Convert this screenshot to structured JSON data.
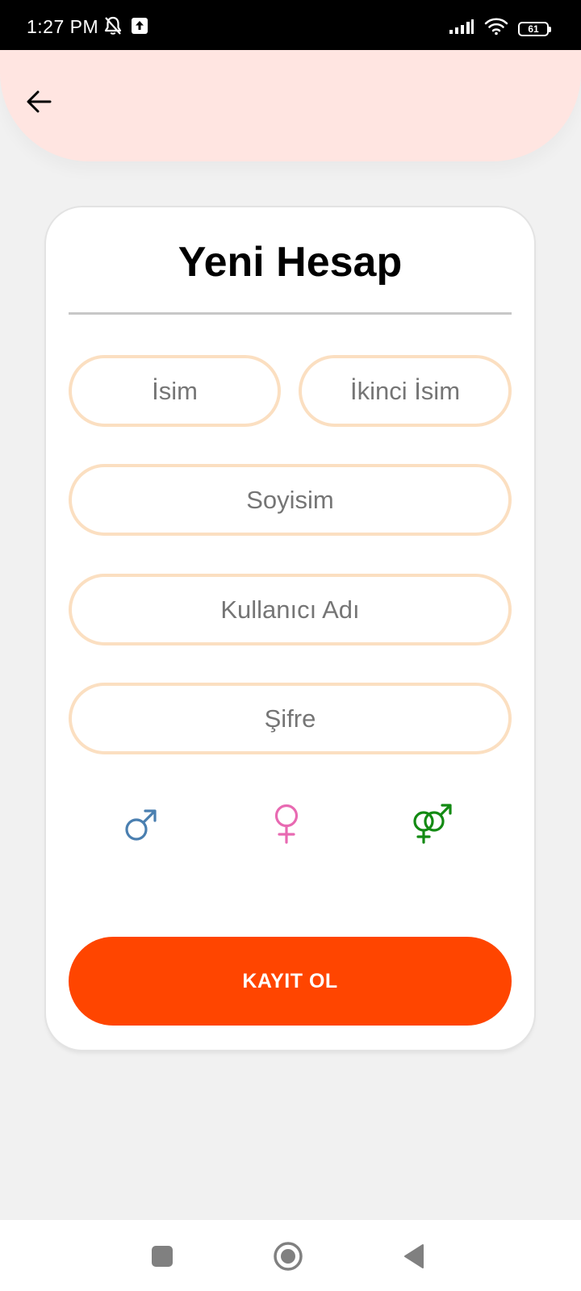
{
  "status_bar": {
    "time": "1:27 PM",
    "battery": "61",
    "icons": [
      "bell-off-icon",
      "upload-icon",
      "signal-icon",
      "wifi-icon",
      "battery-icon"
    ]
  },
  "header": {
    "back_icon": "arrow-left-icon",
    "background_color": "#ffe5e1"
  },
  "form": {
    "title": "Yeni Hesap",
    "fields": {
      "first_name": {
        "placeholder": "İsim",
        "value": ""
      },
      "middle_name": {
        "placeholder": "İkinci İsim",
        "value": ""
      },
      "last_name": {
        "placeholder": "Soyisim",
        "value": ""
      },
      "username": {
        "placeholder": "Kullanıcı Adı",
        "value": ""
      },
      "password": {
        "placeholder": "Şifre",
        "value": ""
      }
    },
    "field_border_color": "#fbdfc1",
    "gender_options": [
      {
        "icon": "male-symbol-icon",
        "color": "#4a7fb0"
      },
      {
        "icon": "female-symbol-icon",
        "color": "#e86ab2"
      },
      {
        "icon": "intersex-symbol-icon",
        "color": "#138a13"
      }
    ],
    "submit_label": "KAYIT OL",
    "submit_color": "#ff4500"
  },
  "nav_bar": {
    "icons": [
      "recents-square-icon",
      "home-circle-icon",
      "back-triangle-icon"
    ]
  }
}
